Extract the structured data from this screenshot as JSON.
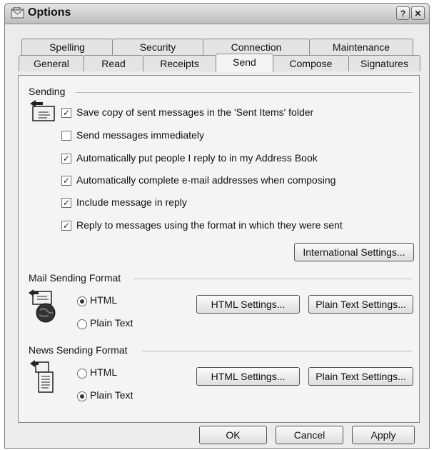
{
  "window": {
    "title": "Options",
    "help_glyph": "?",
    "close_glyph": "✕"
  },
  "tabs": {
    "row1": [
      "Spelling",
      "Security",
      "Connection",
      "Maintenance"
    ],
    "row2": [
      "General",
      "Read",
      "Receipts",
      "Send",
      "Compose",
      "Signatures"
    ],
    "active": "Send"
  },
  "sending": {
    "label": "Sending",
    "icon": "outbox-envelope-icon",
    "options": [
      {
        "label": "Save copy of sent messages in the 'Sent Items' folder",
        "checked": true
      },
      {
        "label": "Send messages immediately",
        "checked": false
      },
      {
        "label": "Automatically put people I reply to in my Address Book",
        "checked": true
      },
      {
        "label": "Automatically complete e-mail addresses when composing",
        "checked": true
      },
      {
        "label": "Include message in reply",
        "checked": true
      },
      {
        "label": "Reply to messages using the format in which they were sent",
        "checked": true
      }
    ],
    "international_button": "International Settings..."
  },
  "mail_format": {
    "label": "Mail Sending Format",
    "icon": "mail-format-icon",
    "html_label": "HTML",
    "plain_label": "Plain Text",
    "selected": "HTML",
    "html_settings_button": "HTML Settings...",
    "plain_settings_button": "Plain Text Settings..."
  },
  "news_format": {
    "label": "News Sending Format",
    "icon": "news-format-icon",
    "html_label": "HTML",
    "plain_label": "Plain Text",
    "selected": "Plain Text",
    "html_settings_button": "HTML Settings...",
    "plain_settings_button": "Plain Text Settings..."
  },
  "footer": {
    "ok": "OK",
    "cancel": "Cancel",
    "apply": "Apply"
  }
}
